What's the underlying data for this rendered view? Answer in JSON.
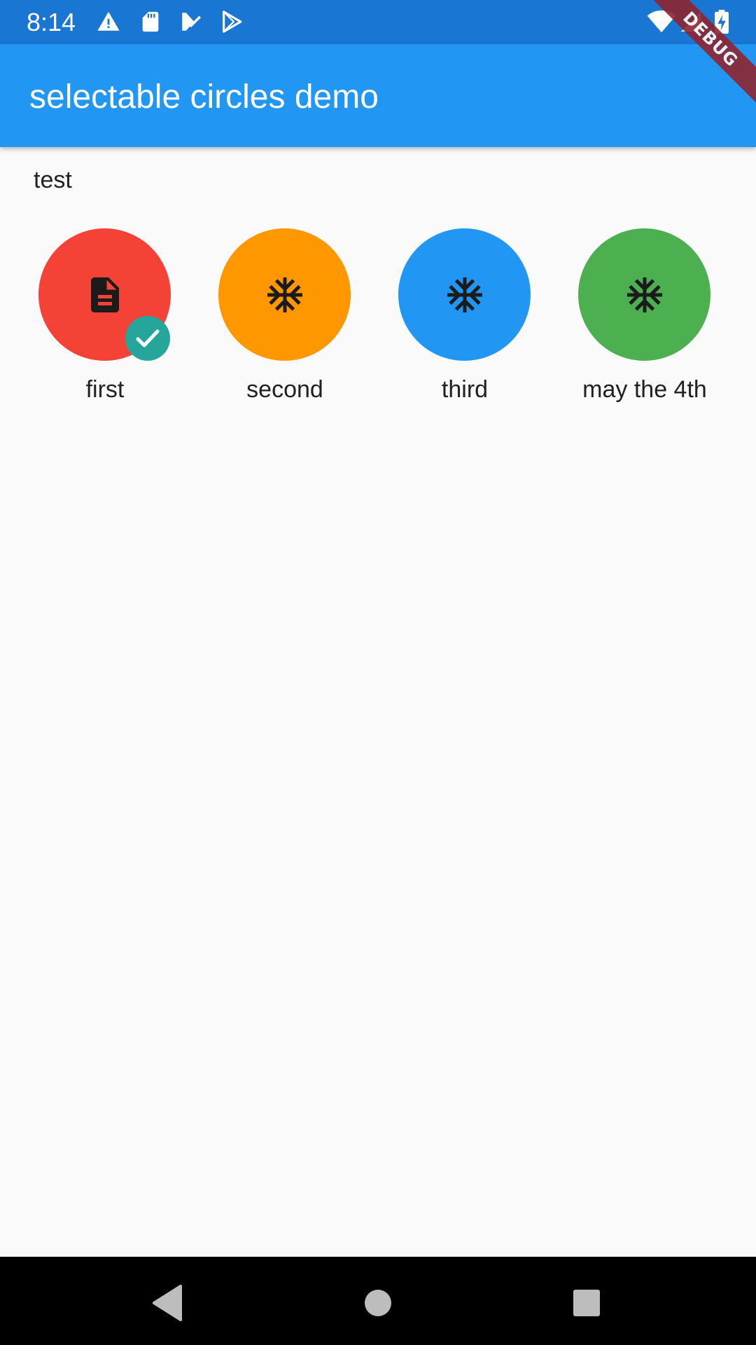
{
  "status_bar": {
    "time": "8:14",
    "left_icons": [
      "warning-icon",
      "sd-card-icon",
      "download-done-icon",
      "play-store-icon"
    ],
    "right_icons": [
      "wifi-icon",
      "cell-signal-icon",
      "battery-charging-icon"
    ],
    "color": "#1976d2"
  },
  "app_bar": {
    "title": "selectable circles demo",
    "color": "#2196f3"
  },
  "debug_banner": {
    "label": "DEBUG",
    "color": "#8e2531"
  },
  "content": {
    "section_label": "test",
    "items": [
      {
        "label": "first",
        "color": "#f44336",
        "icon": "description-icon",
        "selected": true
      },
      {
        "label": "second",
        "color": "#ff9800",
        "icon": "ac-unit-icon",
        "selected": false
      },
      {
        "label": "third",
        "color": "#2196f3",
        "icon": "ac-unit-icon",
        "selected": false
      },
      {
        "label": "may the 4th",
        "color": "#4caf50",
        "icon": "ac-unit-icon",
        "selected": false
      }
    ],
    "selected_badge": {
      "icon": "check-icon",
      "color": "#26a69a"
    }
  },
  "nav_bar": {
    "buttons": [
      "back-icon",
      "home-icon",
      "recents-icon"
    ]
  }
}
